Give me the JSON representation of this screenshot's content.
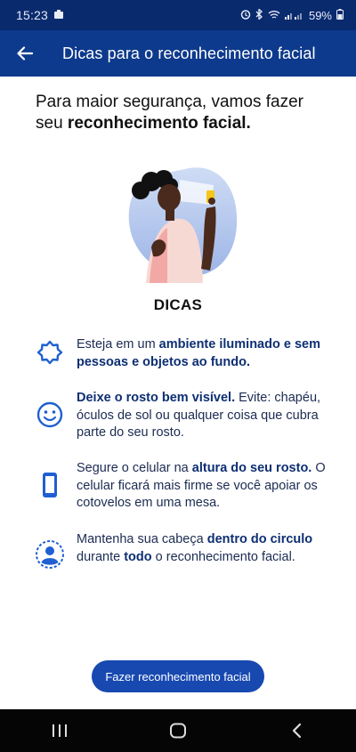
{
  "status_bar": {
    "time": "15:23",
    "battery": "59%"
  },
  "app_bar": {
    "title": "Dicas para o reconhecimento facial"
  },
  "headline": {
    "line1": "Para maior segurança, vamos fazer",
    "line2_prefix": "seu ",
    "line2_bold": "reconhecimento facial."
  },
  "dicas_title": "DICAS",
  "tips": [
    {
      "icon": "sun-icon",
      "parts": [
        "Esteja em um ",
        "ambiente iluminado e sem pessoas e objetos ao fundo."
      ]
    },
    {
      "icon": "smiley-face-icon",
      "parts": [
        "Deixe o rosto bem visível.",
        " Evite: chapéu, óculos de sol ou qualquer coisa que cubra parte do seu rosto."
      ]
    },
    {
      "icon": "smartphone-icon",
      "parts": [
        "Segure o celular na ",
        "altura do seu rosto.",
        " O celular ficará mais firme se você apoiar os cotovelos em uma mesa."
      ]
    },
    {
      "icon": "face-circle-icon",
      "parts": [
        "Mantenha sua cabeça ",
        "dentro do circulo",
        " durante ",
        "todo",
        " o reconhecimento facial."
      ]
    }
  ],
  "cta": {
    "label": "Fazer reconhecimento facial"
  },
  "colors": {
    "primary": "#0d3a8c",
    "status_bar": "#0a2a6e",
    "button": "#1749b1",
    "icon_blue": "#1f5fd1"
  }
}
